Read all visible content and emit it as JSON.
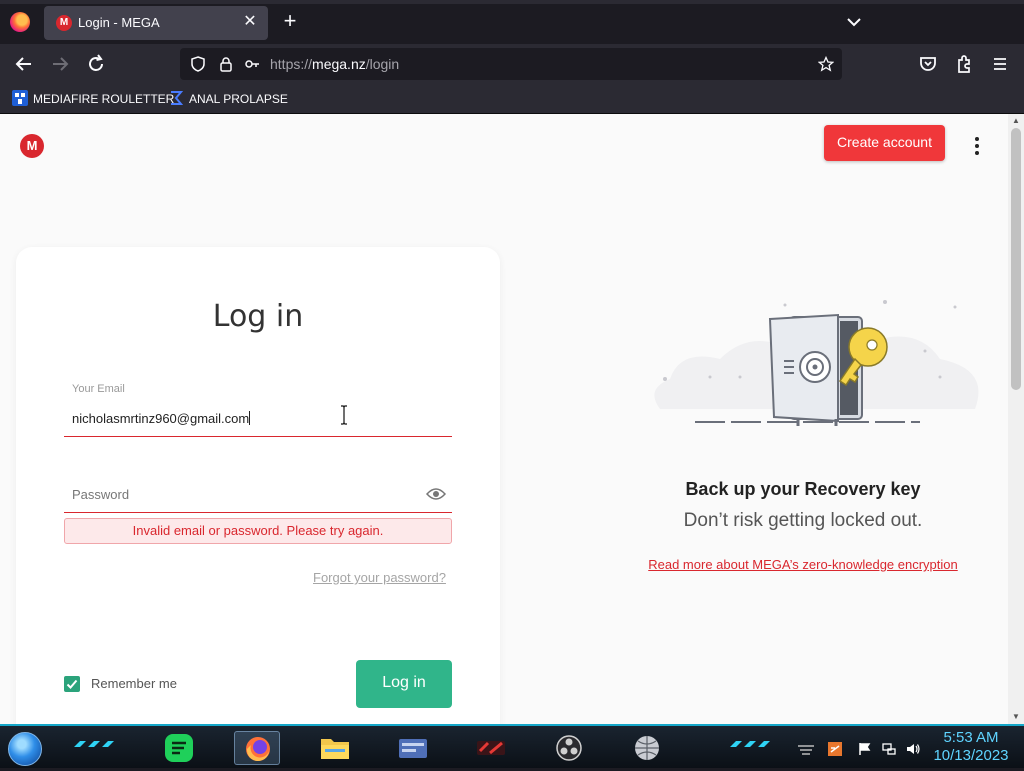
{
  "browser": {
    "tab": {
      "title": "Login - MEGA",
      "favicon": "M"
    },
    "url": {
      "scheme": "https://",
      "host": "mega.nz",
      "path": "/login"
    },
    "bookmarks": [
      {
        "label": "MEDIAFIRE ROULETTER"
      },
      {
        "label": "ANAL PROLAPSE"
      }
    ]
  },
  "page": {
    "logo_letter": "M",
    "create_account_label": "Create account",
    "login": {
      "title": "Log in",
      "email_label": "Your Email",
      "email_value": "nicholasmrtinz960@gmail.com",
      "password_placeholder": "Password",
      "error_message": "Invalid email or password. Please try again.",
      "forgot_label": "Forgot your password?",
      "remember_label": "Remember me",
      "remember_checked": true,
      "login_button_label": "Log in"
    },
    "promo": {
      "title": "Back up your Recovery key",
      "subtitle": "Don’t risk getting locked out.",
      "link": "Read more about MEGA’s zero-knowledge encryption"
    }
  },
  "taskbar": {
    "time": "5:53 AM",
    "date": "10/13/2023"
  },
  "colors": {
    "brand_red": "#d9272e",
    "create_button": "#f0373a",
    "login_button": "#30b58a",
    "checkbox": "#2ba37b",
    "clock": "#5fd4ff"
  }
}
